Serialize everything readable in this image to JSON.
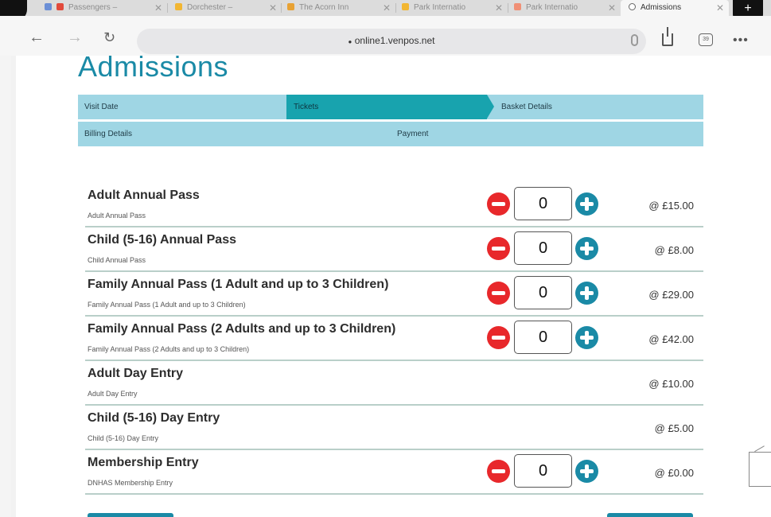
{
  "browser": {
    "tabs": [
      {
        "label": "Passengers –",
        "favicon_color": "#e24a3b"
      },
      {
        "label": "Dorchester –",
        "favicon_color": "#f2b632"
      },
      {
        "label": "The Acorn Inn",
        "favicon_color": "#e8a234"
      },
      {
        "label": "Park Internatio",
        "favicon_color": "#f2b632"
      },
      {
        "label": "Park Internatio",
        "favicon_color": "#f08f75"
      },
      {
        "label": "Admissions",
        "favicon_color": "#666666"
      }
    ],
    "url": "online1.venpos.net",
    "tabs_count": "39"
  },
  "page": {
    "title": "Admissions",
    "steps": {
      "visit_date": "Visit Date",
      "tickets": "Tickets",
      "basket_details": "Basket Details",
      "billing_details": "Billing Details",
      "payment": "Payment"
    },
    "tickets": [
      {
        "name": "Adult Annual Pass",
        "description": "Adult Annual Pass",
        "quantity": "0",
        "price": "@ £15.00",
        "has_stepper": true
      },
      {
        "name": "Child (5-16) Annual Pass",
        "description": "Child Annual Pass",
        "quantity": "0",
        "price": "@ £8.00",
        "has_stepper": true
      },
      {
        "name": "Family Annual Pass (1 Adult and up to 3 Children)",
        "description": "Family Annual Pass (1 Adult and up to 3 Children)",
        "quantity": "0",
        "price": "@ £29.00",
        "has_stepper": true
      },
      {
        "name": "Family Annual Pass (2 Adults and up to 3 Children)",
        "description": "Family Annual Pass (2 Adults and up to 3 Children)",
        "quantity": "0",
        "price": "@ £42.00",
        "has_stepper": true
      },
      {
        "name": "Adult Day Entry",
        "description": "Adult Day Entry",
        "quantity": "",
        "price": "@ £10.00",
        "has_stepper": false
      },
      {
        "name": "Child (5-16) Day Entry",
        "description": "Child (5-16) Day Entry",
        "quantity": "",
        "price": "@ £5.00",
        "has_stepper": false
      },
      {
        "name": "Membership Entry",
        "description": "DNHAS Membership Entry",
        "quantity": "0",
        "price": "@ £0.00",
        "has_stepper": true
      }
    ]
  },
  "colors": {
    "accent": "#1a8aa6",
    "step_bar": "#9fd6e4",
    "step_active": "#18a3ae",
    "minus_button": "#e8282b"
  }
}
